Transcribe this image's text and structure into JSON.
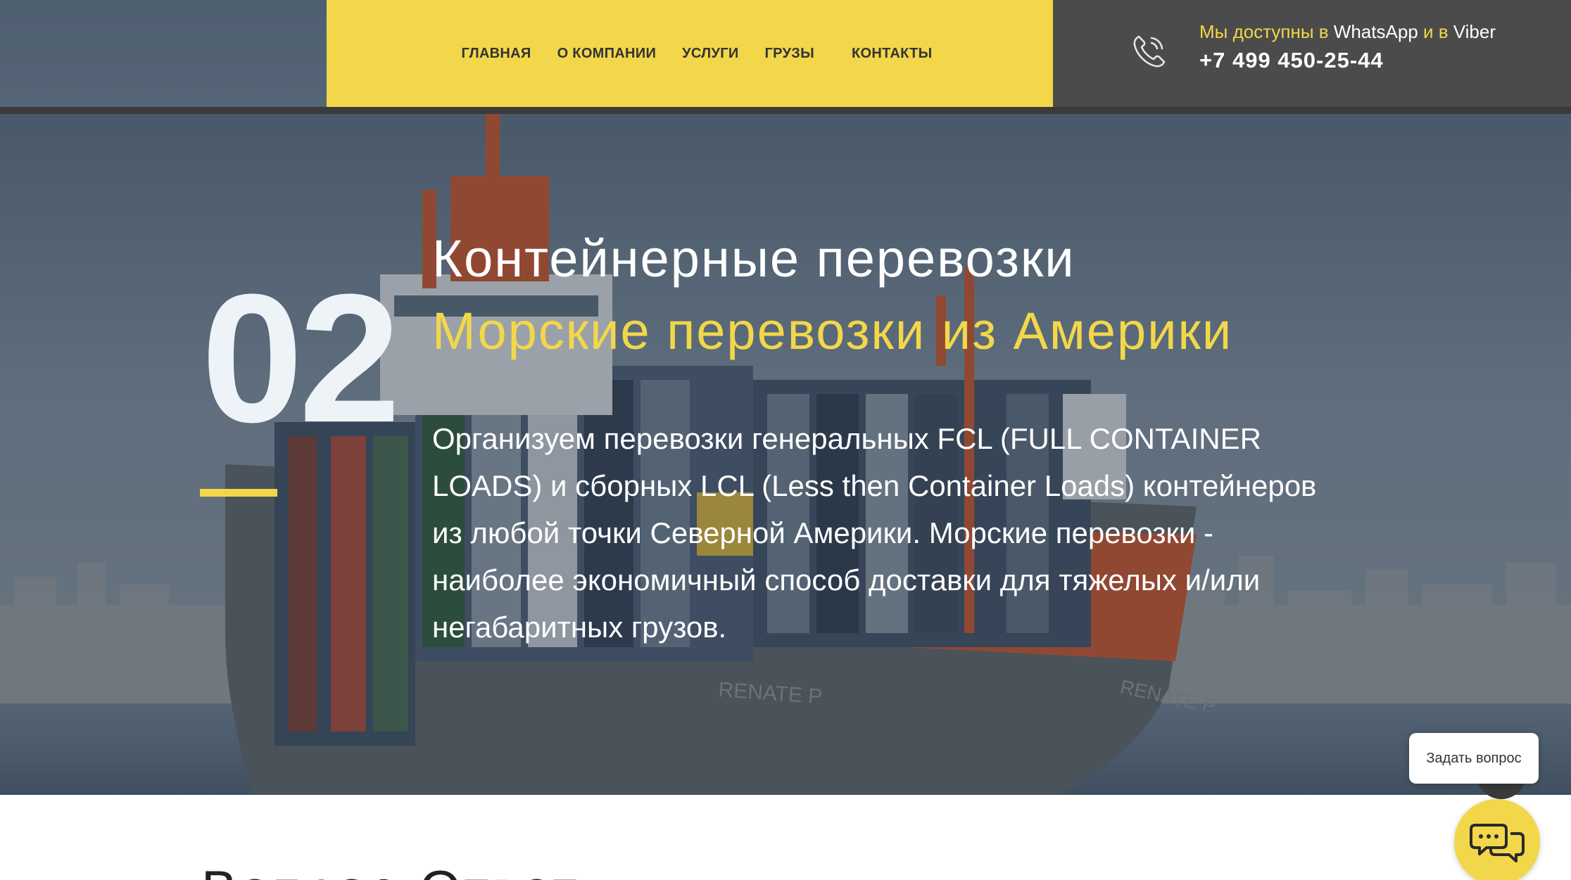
{
  "nav": {
    "items": [
      {
        "label": "ГЛАВНАЯ"
      },
      {
        "label": "О КОМПАНИИ"
      },
      {
        "label": "УСЛУГИ"
      },
      {
        "label": "ГРУЗЫ"
      },
      {
        "label": "КОНТАКТЫ"
      }
    ]
  },
  "contact": {
    "availability_prefix": "Мы доступны в",
    "app_one": "WhatsApp",
    "conjunction": "и в",
    "app_two": "Viber",
    "phone": "+7 499 450-25-44",
    "icon": "phone-icon"
  },
  "hero": {
    "number": "02",
    "title": "Контейнерные перевозки",
    "subtitle": "Морские перевозки из Америки",
    "text": "Организуем перевозки генеральных FCL (FULL CONTAINER LOADS) и сборных LCL (Less then Container Loads) контейнеров из любой точки Северной Америки. Морские перевозки - наиболее экономичный способ доставки для тяжелых и/или негабаритных грузов.",
    "ship_name_left": "RENATE P",
    "ship_name_right": "RENATE P"
  },
  "section": {
    "heading_partial": "Вопрос-Ответ"
  },
  "chat": {
    "tooltip": "Задать вопрос",
    "icon": "chat-icon"
  },
  "colors": {
    "accent": "#f2d74a",
    "dark": "#4b4b4b",
    "strip": "#3b3b3b"
  }
}
